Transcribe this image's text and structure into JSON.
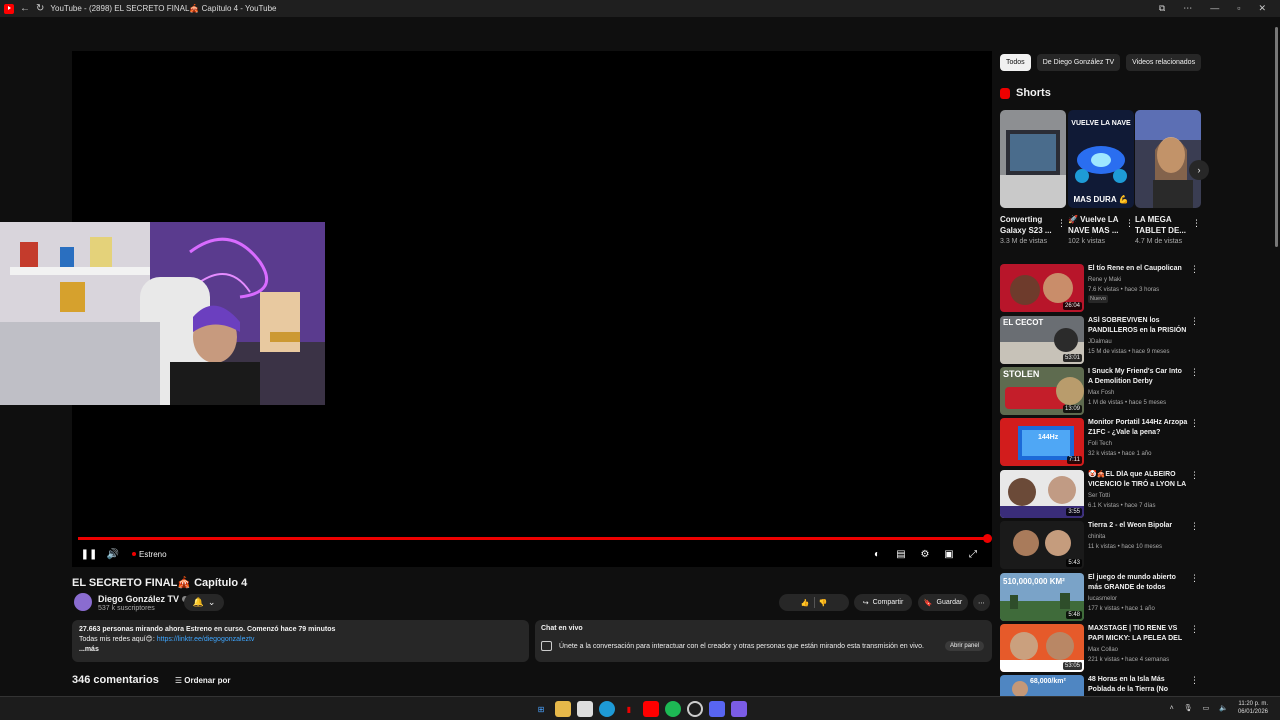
{
  "window": {
    "title": "YouTube - (2898) EL SECRETO FINAL🎪 Capítulo 4 - YouTube"
  },
  "player": {
    "live_label": "Estreno"
  },
  "video": {
    "title": "EL SECRETO FINAL🎪 Capítulo 4",
    "channel_name": "Diego González TV",
    "subscribers": "537 k suscriptores",
    "share_label": "Compartir",
    "save_label": "Guardar"
  },
  "description": {
    "stats": "27.663 personas mirando ahora  Estreno en curso. Comenzó hace 79 minutos",
    "line2_text": "Todas mis redes aquí😊: ",
    "line2_link": "https://linktr.ee/diegogonzaleztv",
    "more": "...más"
  },
  "chat": {
    "title": "Chat en vivo",
    "message": "Únete a la conversación para interactuar con el creador y otras personas que están mirando esta transmisión en vivo.",
    "open_panel": "Abrir panel"
  },
  "comments": {
    "count_label": "346 comentarios",
    "sort_label": "Ordenar por"
  },
  "chips": [
    "Todos",
    "De Diego González TV",
    "Videos relacionados"
  ],
  "shorts": {
    "heading": "Shorts",
    "items": [
      {
        "title": "Converting Galaxy S23 ...",
        "views": "3.3 M de vistas",
        "overlay": ""
      },
      {
        "title": "🚀 Vuelve LA NAVE MAS ...",
        "views": "102 k vistas",
        "overlay_top": "VUELVE LA NAVE",
        "overlay_bottom": "MAS DURA 💪"
      },
      {
        "title": "LA MEGA TABLET DE...",
        "views": "4.7 M de vistas",
        "overlay": ""
      }
    ]
  },
  "recommendations": [
    {
      "title": "El tío Rene en el Caupolican",
      "channel": "Rene y Maki",
      "meta": "7.6 K vistas • hace 3 horas",
      "duration": "26:04",
      "badge": "Nuevo",
      "verified": false,
      "thumb_text": ""
    },
    {
      "title": "ASÍ SOBREVIVEN los PANDILLEROS en la PRISIÓN ...",
      "channel": "JDalmau",
      "meta": "15 M de vistas • hace 9 meses",
      "duration": "53:01",
      "badge": "",
      "verified": true,
      "thumb_text": "EL CECOT"
    },
    {
      "title": "I Snuck My Friend's Car Into A Demolition Derby",
      "channel": "Max Fosh",
      "meta": "1 M de vistas • hace 5 meses",
      "duration": "13:09",
      "badge": "",
      "verified": true,
      "thumb_text": "STOLEN"
    },
    {
      "title": "Monitor Portatil 144Hz Arzopa Z1FC - ¿Vale la pena?",
      "channel": "Foli Tech",
      "meta": "32 k vistas • hace 1 año",
      "duration": "7:11",
      "badge": "",
      "verified": false,
      "thumb_text": "144Hz"
    },
    {
      "title": "🤡🎪EL DÍA que ALBEIRO VICENCIO le TIRÓ a LYON LA F",
      "channel": "Ser Totti",
      "meta": "6.1 K vistas • hace 7 días",
      "duration": "3:55",
      "badge": "",
      "verified": false,
      "thumb_text": ""
    },
    {
      "title": "Tierra 2 - el Weon Bipolar",
      "channel": "chinita",
      "meta": "11 k vistas • hace 10 meses",
      "duration": "5:43",
      "badge": "",
      "verified": false,
      "thumb_text": ""
    },
    {
      "title": "El juego de mundo abierto más GRANDE de todos",
      "channel": "lucasmelor",
      "meta": "177 k vistas • hace 1 año",
      "duration": "5:48",
      "badge": "",
      "verified": true,
      "thumb_text": "510,000,000 KM²"
    },
    {
      "title": "MAXSTAGE | TÍO RENE VS PAPI MICKY: LA PELEA DEL SIGLO",
      "channel": "Max Collao",
      "meta": "221 k vistas • hace 4 semanas",
      "duration": "53:05",
      "badge": "",
      "verified": false,
      "thumb_text": ""
    },
    {
      "title": "48 Horas en la Isla Más Poblada de la Tierra (No puedo olvidar l...",
      "channel": "",
      "meta": "",
      "duration": "",
      "badge": "",
      "verified": false,
      "thumb_text": "68,000/km²"
    }
  ],
  "taskbar": {
    "time": "11:20 p. m.",
    "date": "06/01/2026"
  },
  "colors": {
    "background": "#0f0f0f",
    "accent_red": "#ff0000",
    "link_blue": "#3ea6ff"
  }
}
